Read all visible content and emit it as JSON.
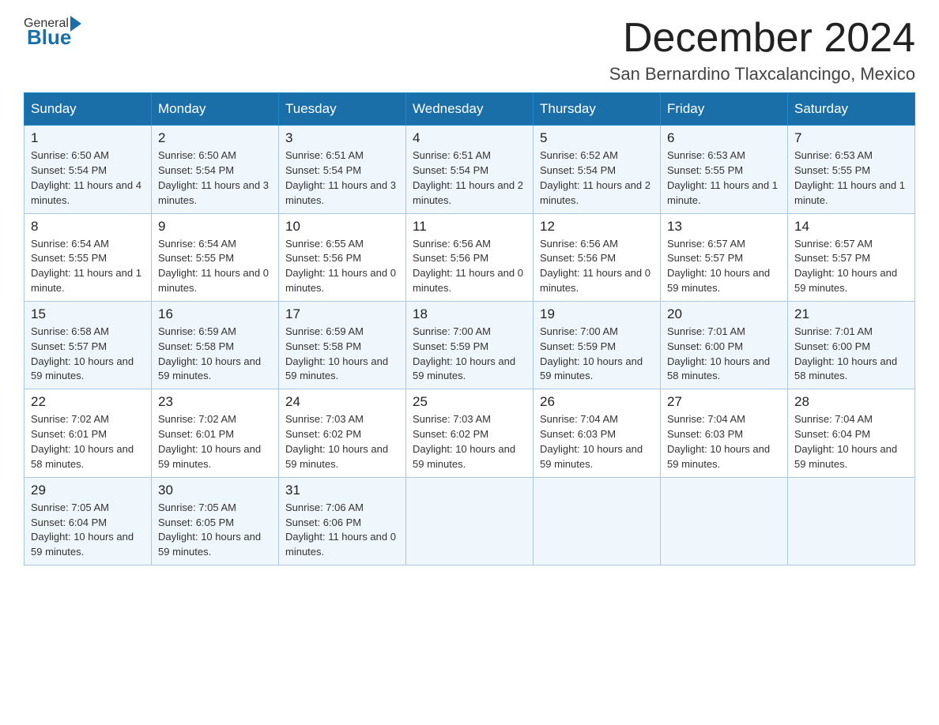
{
  "header": {
    "logo_general": "General",
    "logo_blue": "Blue",
    "title": "December 2024",
    "subtitle": "San Bernardino Tlaxcalancingo, Mexico"
  },
  "weekdays": [
    "Sunday",
    "Monday",
    "Tuesday",
    "Wednesday",
    "Thursday",
    "Friday",
    "Saturday"
  ],
  "weeks": [
    [
      {
        "day": "1",
        "sunrise": "6:50 AM",
        "sunset": "5:54 PM",
        "daylight": "11 hours and 4 minutes."
      },
      {
        "day": "2",
        "sunrise": "6:50 AM",
        "sunset": "5:54 PM",
        "daylight": "11 hours and 3 minutes."
      },
      {
        "day": "3",
        "sunrise": "6:51 AM",
        "sunset": "5:54 PM",
        "daylight": "11 hours and 3 minutes."
      },
      {
        "day": "4",
        "sunrise": "6:51 AM",
        "sunset": "5:54 PM",
        "daylight": "11 hours and 2 minutes."
      },
      {
        "day": "5",
        "sunrise": "6:52 AM",
        "sunset": "5:54 PM",
        "daylight": "11 hours and 2 minutes."
      },
      {
        "day": "6",
        "sunrise": "6:53 AM",
        "sunset": "5:55 PM",
        "daylight": "11 hours and 1 minute."
      },
      {
        "day": "7",
        "sunrise": "6:53 AM",
        "sunset": "5:55 PM",
        "daylight": "11 hours and 1 minute."
      }
    ],
    [
      {
        "day": "8",
        "sunrise": "6:54 AM",
        "sunset": "5:55 PM",
        "daylight": "11 hours and 1 minute."
      },
      {
        "day": "9",
        "sunrise": "6:54 AM",
        "sunset": "5:55 PM",
        "daylight": "11 hours and 0 minutes."
      },
      {
        "day": "10",
        "sunrise": "6:55 AM",
        "sunset": "5:56 PM",
        "daylight": "11 hours and 0 minutes."
      },
      {
        "day": "11",
        "sunrise": "6:56 AM",
        "sunset": "5:56 PM",
        "daylight": "11 hours and 0 minutes."
      },
      {
        "day": "12",
        "sunrise": "6:56 AM",
        "sunset": "5:56 PM",
        "daylight": "11 hours and 0 minutes."
      },
      {
        "day": "13",
        "sunrise": "6:57 AM",
        "sunset": "5:57 PM",
        "daylight": "10 hours and 59 minutes."
      },
      {
        "day": "14",
        "sunrise": "6:57 AM",
        "sunset": "5:57 PM",
        "daylight": "10 hours and 59 minutes."
      }
    ],
    [
      {
        "day": "15",
        "sunrise": "6:58 AM",
        "sunset": "5:57 PM",
        "daylight": "10 hours and 59 minutes."
      },
      {
        "day": "16",
        "sunrise": "6:59 AM",
        "sunset": "5:58 PM",
        "daylight": "10 hours and 59 minutes."
      },
      {
        "day": "17",
        "sunrise": "6:59 AM",
        "sunset": "5:58 PM",
        "daylight": "10 hours and 59 minutes."
      },
      {
        "day": "18",
        "sunrise": "7:00 AM",
        "sunset": "5:59 PM",
        "daylight": "10 hours and 59 minutes."
      },
      {
        "day": "19",
        "sunrise": "7:00 AM",
        "sunset": "5:59 PM",
        "daylight": "10 hours and 59 minutes."
      },
      {
        "day": "20",
        "sunrise": "7:01 AM",
        "sunset": "6:00 PM",
        "daylight": "10 hours and 58 minutes."
      },
      {
        "day": "21",
        "sunrise": "7:01 AM",
        "sunset": "6:00 PM",
        "daylight": "10 hours and 58 minutes."
      }
    ],
    [
      {
        "day": "22",
        "sunrise": "7:02 AM",
        "sunset": "6:01 PM",
        "daylight": "10 hours and 58 minutes."
      },
      {
        "day": "23",
        "sunrise": "7:02 AM",
        "sunset": "6:01 PM",
        "daylight": "10 hours and 59 minutes."
      },
      {
        "day": "24",
        "sunrise": "7:03 AM",
        "sunset": "6:02 PM",
        "daylight": "10 hours and 59 minutes."
      },
      {
        "day": "25",
        "sunrise": "7:03 AM",
        "sunset": "6:02 PM",
        "daylight": "10 hours and 59 minutes."
      },
      {
        "day": "26",
        "sunrise": "7:04 AM",
        "sunset": "6:03 PM",
        "daylight": "10 hours and 59 minutes."
      },
      {
        "day": "27",
        "sunrise": "7:04 AM",
        "sunset": "6:03 PM",
        "daylight": "10 hours and 59 minutes."
      },
      {
        "day": "28",
        "sunrise": "7:04 AM",
        "sunset": "6:04 PM",
        "daylight": "10 hours and 59 minutes."
      }
    ],
    [
      {
        "day": "29",
        "sunrise": "7:05 AM",
        "sunset": "6:04 PM",
        "daylight": "10 hours and 59 minutes."
      },
      {
        "day": "30",
        "sunrise": "7:05 AM",
        "sunset": "6:05 PM",
        "daylight": "10 hours and 59 minutes."
      },
      {
        "day": "31",
        "sunrise": "7:06 AM",
        "sunset": "6:06 PM",
        "daylight": "11 hours and 0 minutes."
      },
      null,
      null,
      null,
      null
    ]
  ]
}
